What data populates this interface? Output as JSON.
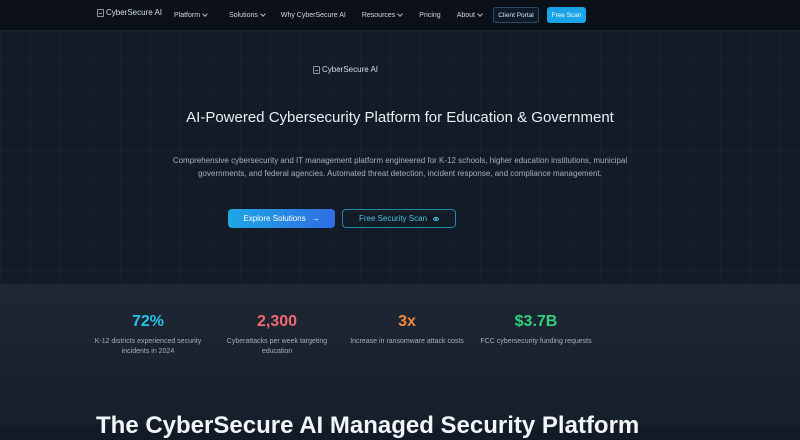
{
  "nav": {
    "logo_alt": "CyberSecure AI",
    "items": [
      {
        "label": "Platform",
        "has_dropdown": true
      },
      {
        "label": "Solutions",
        "has_dropdown": true
      },
      {
        "label": "Why CyberSecure AI",
        "has_dropdown": false
      },
      {
        "label": "Resources",
        "has_dropdown": true
      },
      {
        "label": "Pricing",
        "has_dropdown": false
      },
      {
        "label": "About",
        "has_dropdown": true
      }
    ],
    "client_portal": "Client Portal",
    "free_scan": "Free Scan"
  },
  "hero": {
    "logo_alt": "CyberSecure AI",
    "title": "AI-Powered Cybersecurity Platform for Education & Government",
    "subtitle": "Comprehensive cybersecurity and IT management platform engineered for K-12 schools, higher education institutions, municipal governments, and federal agencies. Automated threat detection, incident response, and compliance management.",
    "explore_button": "Explore Solutions",
    "explore_icon": "→",
    "free_scan_button": "Free Security Scan"
  },
  "stats": [
    {
      "value": "72%",
      "label": "K-12 districts experienced security incidents in 2024",
      "color": "#22c3e6"
    },
    {
      "value": "2,300",
      "label": "Cyberattacks per week targeting education",
      "color": "#f06a73"
    },
    {
      "value": "3x",
      "label": "Increase in ransomware attack costs",
      "color": "#f28a3c"
    },
    {
      "value": "$3.7B",
      "label": "FCC cybersecurity funding requests",
      "color": "#2fd07e"
    }
  ],
  "section": {
    "heading": "The CyberSecure AI Managed Security Platform"
  },
  "colors": {
    "accent": "#1aa3e8",
    "background": "#121a26"
  }
}
